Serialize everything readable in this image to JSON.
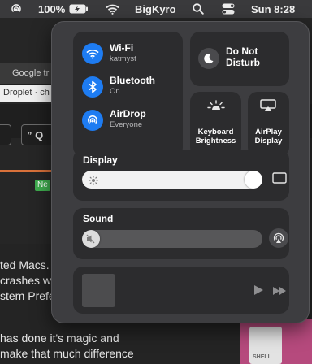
{
  "menubar": {
    "battery_percent": "100%",
    "user": "BigKyro",
    "clock": "Sun 8:28"
  },
  "background": {
    "tab_google": "Google tr",
    "url_text": "Droplet · ch",
    "button_q": "” Q",
    "new_badge": "Ne",
    "doc_lines": [
      "ted Macs.",
      "crashes w",
      "stem Prefe",
      "has done it's magic and",
      "make that much difference"
    ],
    "shelf_label": "SHELL"
  },
  "control_center": {
    "wifi": {
      "title": "Wi-Fi",
      "subtitle": "katmyst",
      "icon": "wifi-icon"
    },
    "bluetooth": {
      "title": "Bluetooth",
      "subtitle": "On",
      "icon": "bluetooth-icon"
    },
    "airdrop": {
      "title": "AirDrop",
      "subtitle": "Everyone",
      "icon": "airdrop-icon"
    },
    "do_not_disturb": {
      "title_line1": "Do Not",
      "title_line2": "Disturb",
      "icon": "moon-icon"
    },
    "keyboard_brightness": {
      "line1": "Keyboard",
      "line2": "Brightness",
      "icon": "keyboard-brightness-icon"
    },
    "airplay_display": {
      "line1": "AirPlay",
      "line2": "Display",
      "icon": "airplay-icon"
    },
    "display": {
      "label": "Display",
      "level_fraction": 1.0
    },
    "sound": {
      "label": "Sound",
      "level_fraction": 0.0,
      "muted": true
    },
    "now_playing": {
      "icon_play": "play-icon",
      "icon_forward": "fast-forward-icon"
    }
  },
  "colors": {
    "accent_blue": "#1e7cf2",
    "panel_bg": "#3d3d40",
    "tile_bg": "#2c2c2e"
  }
}
